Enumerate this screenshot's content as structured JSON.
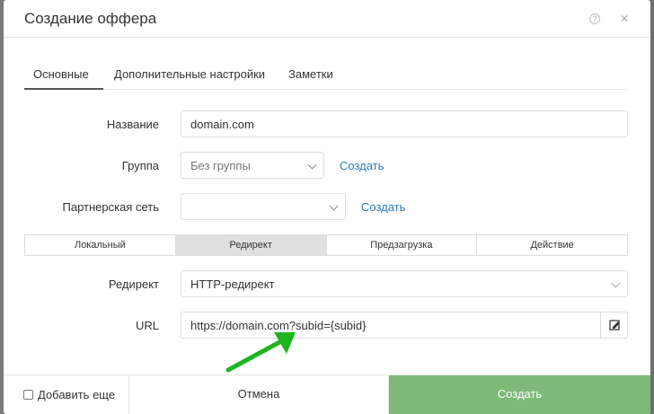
{
  "modal": {
    "title": "Создание оффера",
    "help_icon": "?",
    "close_icon": "×"
  },
  "tabs": [
    {
      "label": "Основные",
      "active": true
    },
    {
      "label": "Дополнительные настройки",
      "active": false
    },
    {
      "label": "Заметки",
      "active": false
    }
  ],
  "form": {
    "name": {
      "label": "Название",
      "value": "domain.com"
    },
    "group": {
      "label": "Группа",
      "value": "Без группы",
      "create_link": "Создать"
    },
    "network": {
      "label": "Партнерская сеть",
      "value": "",
      "create_link": "Создать"
    },
    "mode_tabs": [
      {
        "label": "Локальный",
        "active": false
      },
      {
        "label": "Редирект",
        "active": true
      },
      {
        "label": "Предзагрузка",
        "active": false
      },
      {
        "label": "Действие",
        "active": false
      }
    ],
    "redirect": {
      "label": "Редирект",
      "value": "HTTP-редирект"
    },
    "url": {
      "label": "URL",
      "value": "https://domain.com?subid={subid}"
    }
  },
  "footer": {
    "add_more_label": "Добавить еще",
    "add_more_checked": false,
    "cancel_label": "Отмена",
    "create_label": "Создать"
  },
  "colors": {
    "accent_green": "#7eb979",
    "link_blue": "#2f7bbf",
    "arrow_green": "#1fb51f"
  }
}
